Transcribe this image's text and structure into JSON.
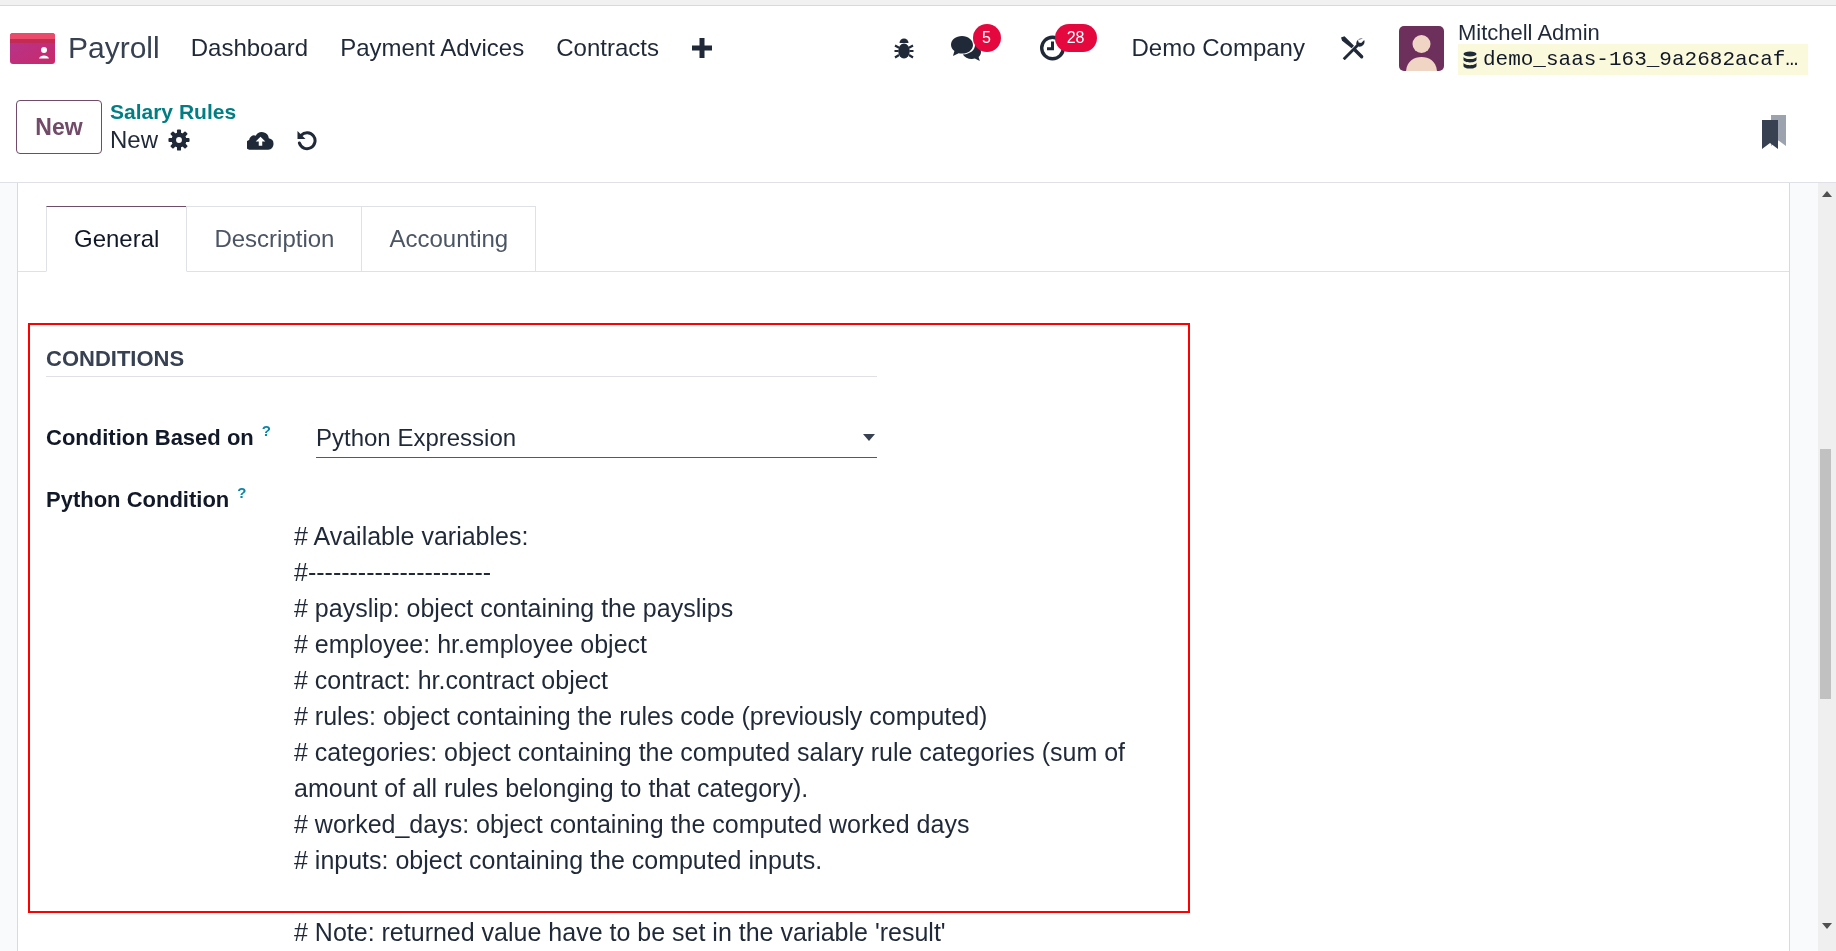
{
  "navbar": {
    "app_name": "Payroll",
    "menu": [
      {
        "label": "Dashboard"
      },
      {
        "label": "Payment Advices"
      },
      {
        "label": "Contracts"
      }
    ],
    "systray": {
      "message_count": "5",
      "activity_count": "28",
      "company": "Demo Company",
      "user_name": "Mitchell Admin",
      "database": "demo_saas-163_9a2682acaf…"
    }
  },
  "control_panel": {
    "new_button": "New",
    "breadcrumb": "Salary Rules",
    "record_title": "New"
  },
  "tabs": [
    {
      "label": "General",
      "selected": true
    },
    {
      "label": "Description",
      "selected": false
    },
    {
      "label": "Accounting",
      "selected": false
    }
  ],
  "conditions": {
    "heading": "CONDITIONS",
    "fields": [
      {
        "kind": "select",
        "label": "Condition Based on",
        "help": "?",
        "value": "Python Expression"
      },
      {
        "kind": "code",
        "label": "Python Condition",
        "help": "?",
        "blocks": [
          [
            "# Available variables:",
            "#----------------------",
            "# payslip: object containing the payslips",
            "# employee: hr.employee object",
            "# contract: hr.contract object",
            "# rules: object containing the rules code (previously computed)",
            "# categories: object containing the computed salary rule categories (sum of",
            "amount of all rules belonging to that category).",
            "# worked_days: object containing the computed worked days",
            "# inputs: object containing the computed inputs."
          ],
          [
            "# Note: returned value have to be set in the variable 'result'"
          ]
        ]
      }
    ]
  }
}
